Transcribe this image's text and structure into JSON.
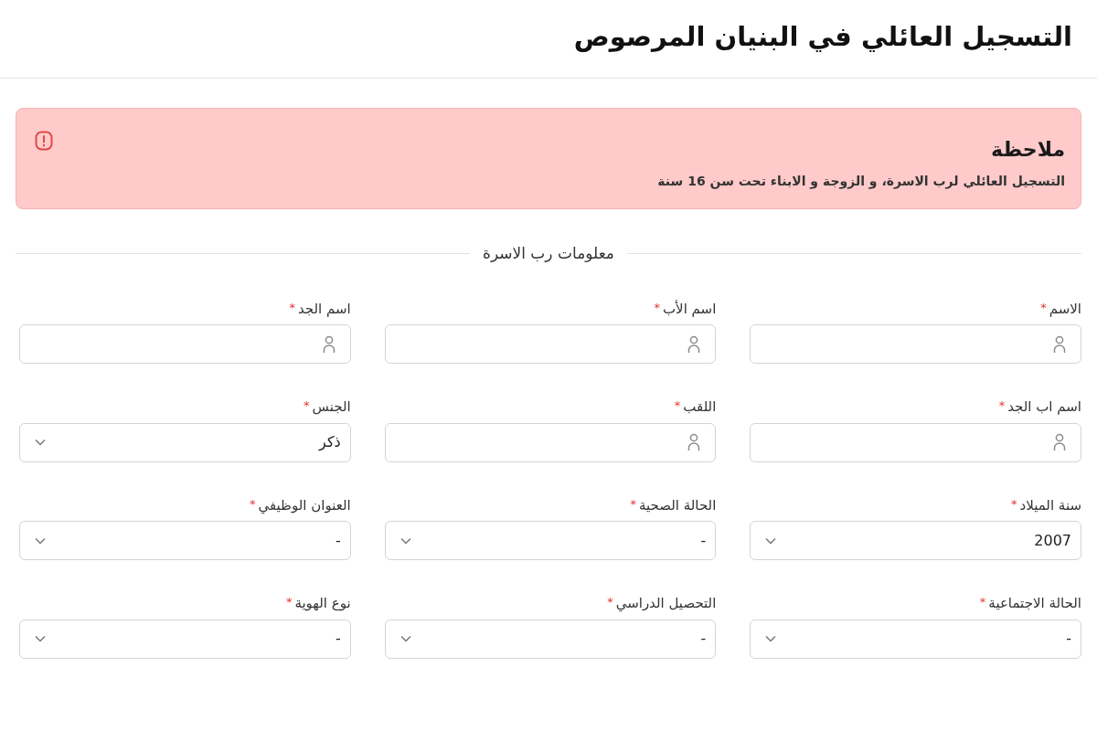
{
  "header": {
    "title": "التسجيل العائلي في البنيان المرصوص"
  },
  "notice": {
    "title": "ملاحظة",
    "text": "التسجيل العائلي لرب الاسرة، و الزوجة و الابناء تحت سن 16 سنة"
  },
  "section": {
    "title": "معلومات رب الاسرة"
  },
  "fields": [
    {
      "label": "الاسم",
      "required_mark": "*",
      "kind": "text"
    },
    {
      "label": "اسم الأب",
      "required_mark": "*",
      "kind": "text"
    },
    {
      "label": "اسم الجد",
      "required_mark": "*",
      "kind": "text"
    },
    {
      "label": "اسم اب الجد",
      "required_mark": "*",
      "kind": "text"
    },
    {
      "label": "اللقب",
      "required_mark": "*",
      "kind": "text"
    },
    {
      "label": "الجنس",
      "required_mark": "*",
      "kind": "select",
      "value": "ذكر"
    },
    {
      "label": "سنة الميلاد",
      "required_mark": "*",
      "kind": "select",
      "value": "2007"
    },
    {
      "label": "الحالة الصحية",
      "required_mark": "*",
      "kind": "select",
      "value": "-"
    },
    {
      "label": "العنوان الوظيفي",
      "required_mark": "*",
      "kind": "select",
      "value": "-"
    },
    {
      "label": "الحالة الاجتماعية",
      "required_mark": "*",
      "kind": "select",
      "value": "-"
    },
    {
      "label": "التحصيل الدراسي",
      "required_mark": "*",
      "kind": "select",
      "value": "-"
    },
    {
      "label": "نوع الهوية",
      "required_mark": "*",
      "kind": "select",
      "value": "-"
    }
  ]
}
